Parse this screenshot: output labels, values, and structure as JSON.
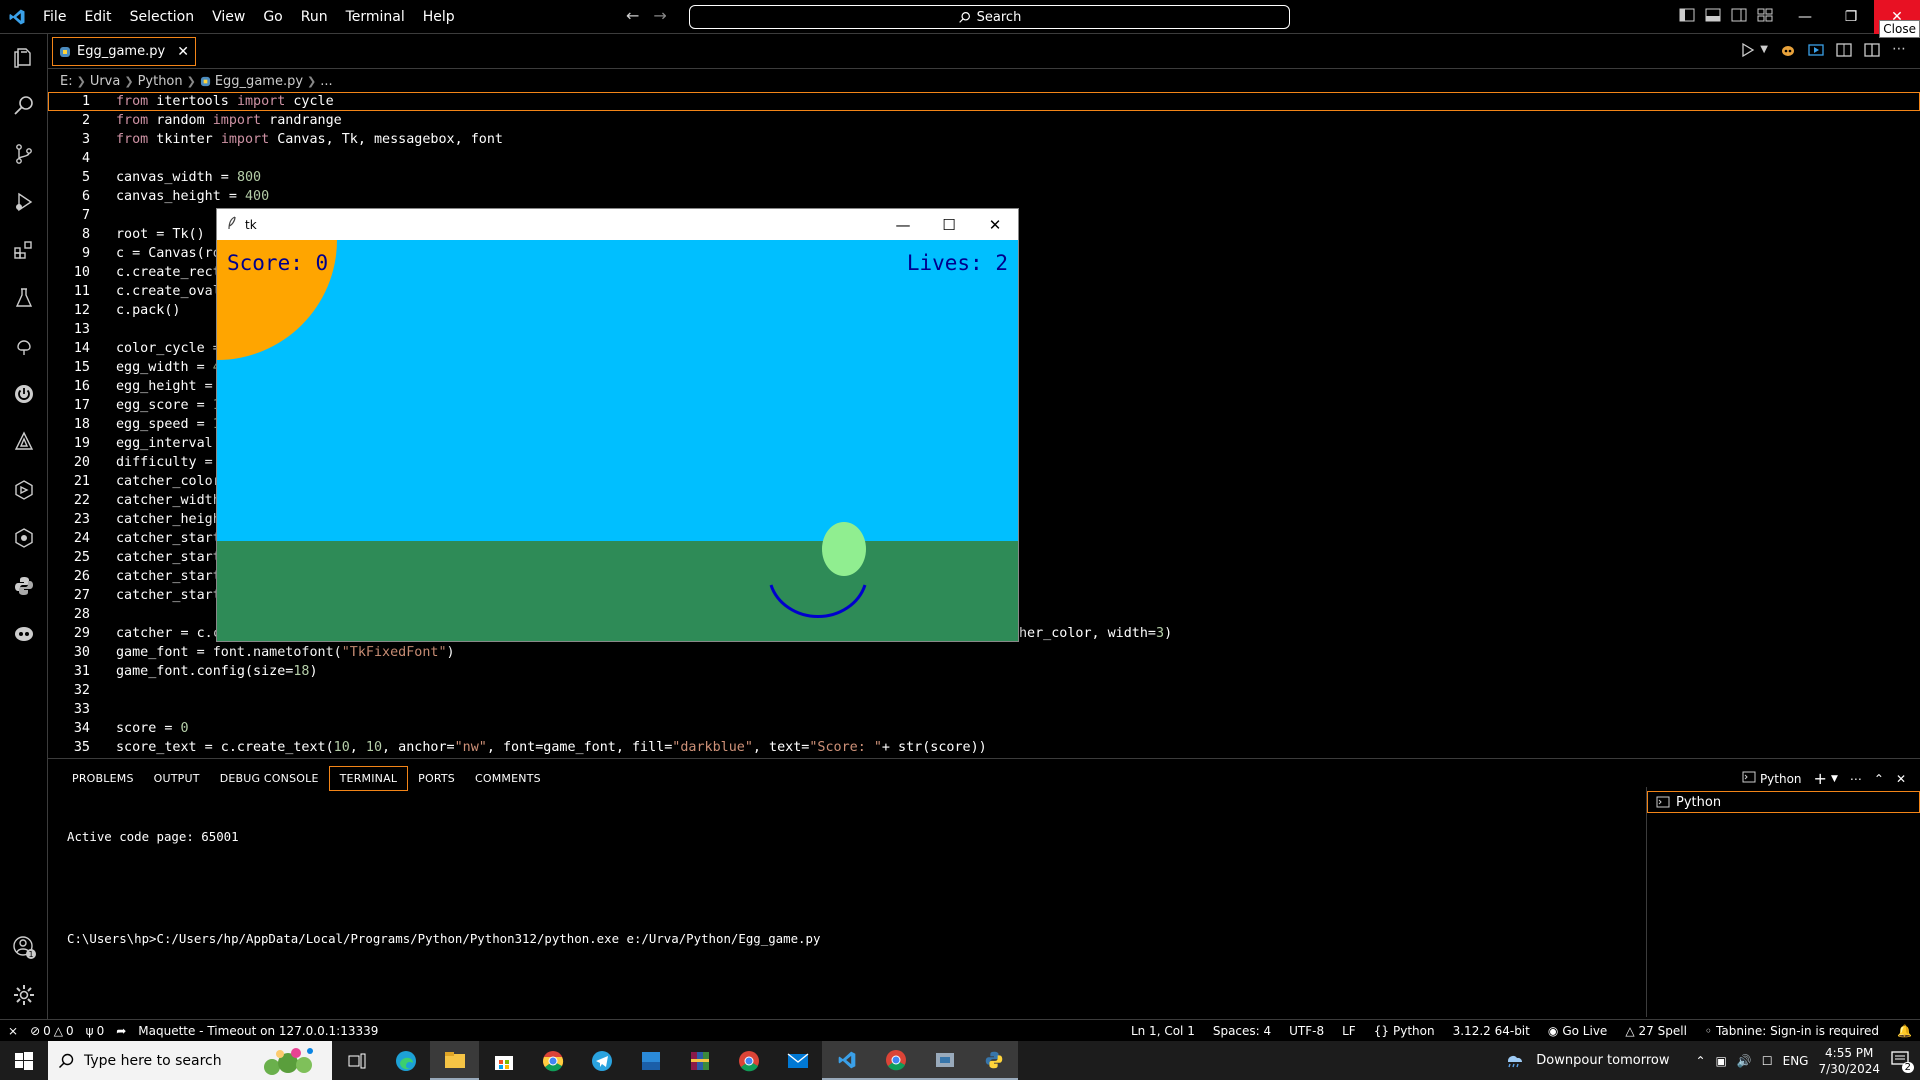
{
  "titlebar": {
    "menu": [
      "File",
      "Edit",
      "Selection",
      "View",
      "Go",
      "Run",
      "Terminal",
      "Help"
    ],
    "search_label": "Search",
    "close_tooltip": "Close"
  },
  "tab": {
    "label": "Egg_game.py"
  },
  "breadcrumb": [
    "E:",
    "Urva",
    "Python",
    "Egg_game.py",
    "..."
  ],
  "code": [
    {
      "n": "1",
      "t": "from itertools import cycle"
    },
    {
      "n": "2",
      "t": "from random import randrange"
    },
    {
      "n": "3",
      "t": "from tkinter import Canvas, Tk, messagebox, font"
    },
    {
      "n": "4",
      "t": ""
    },
    {
      "n": "5",
      "t": "canvas_width = 800"
    },
    {
      "n": "6",
      "t": "canvas_height = 400"
    },
    {
      "n": "7",
      "t": ""
    },
    {
      "n": "8",
      "t": "root = Tk()"
    },
    {
      "n": "9",
      "t": "c = Canvas(ro"
    },
    {
      "n": "10",
      "t": "c.create_rect"
    },
    {
      "n": "11",
      "t": "c.create_oval"
    },
    {
      "n": "12",
      "t": "c.pack()"
    },
    {
      "n": "13",
      "t": ""
    },
    {
      "n": "14",
      "t": "color_cycle ="
    },
    {
      "n": "15",
      "t": "egg_width = 4"
    },
    {
      "n": "16",
      "t": "egg_height ="
    },
    {
      "n": "17",
      "t": "egg_score = 1"
    },
    {
      "n": "18",
      "t": "egg_speed = 1"
    },
    {
      "n": "19",
      "t": "egg_interval"
    },
    {
      "n": "20",
      "t": "difficulty ="
    },
    {
      "n": "21",
      "t": "catcher_color"
    },
    {
      "n": "22",
      "t": "catcher_width"
    },
    {
      "n": "23",
      "t": "catcher_heigh"
    },
    {
      "n": "24",
      "t": "catcher_start"
    },
    {
      "n": "25",
      "t": "catcher_start"
    },
    {
      "n": "26",
      "t": "catcher_start"
    },
    {
      "n": "27",
      "t": "catcher_start"
    },
    {
      "n": "28",
      "t": ""
    },
    {
      "n": "29",
      "t": "catcher = c.c                                                                               =\"arc\", outline=catcher_color, width=3)"
    },
    {
      "n": "30",
      "t": "game_font = font.nametofont(\"TkFixedFont\")"
    },
    {
      "n": "31",
      "t": "game_font.config(size=18)"
    },
    {
      "n": "32",
      "t": ""
    },
    {
      "n": "33",
      "t": ""
    },
    {
      "n": "34",
      "t": "score = 0"
    },
    {
      "n": "35",
      "t": "score_text = c.create_text(10, 10, anchor=\"nw\", font=game_font, fill=\"darkblue\", text=\"Score: \"+ str(score))"
    }
  ],
  "panel": {
    "tabs": [
      "PROBLEMS",
      "OUTPUT",
      "DEBUG CONSOLE",
      "TERMINAL",
      "PORTS",
      "COMMENTS"
    ],
    "active_tab": "TERMINAL",
    "shell_label": "Python",
    "terminal_lines": [
      "Active code page: 65001",
      "",
      "C:\\Users\\hp>C:/Users/hp/AppData/Local/Programs/Python/Python312/python.exe e:/Urva/Python/Egg_game.py"
    ],
    "side_terminal": "Python"
  },
  "statusbar": {
    "errors": "0",
    "warnings": "0",
    "ports": "0",
    "maquette": "Maquette - Timeout on 127.0.0.1:13339",
    "position": "Ln 1, Col 1",
    "spaces": "Spaces: 4",
    "encoding": "UTF-8",
    "eol": "LF",
    "language": "Python",
    "interpreter": "3.12.2 64-bit",
    "golive": "Go Live",
    "spell": "27 Spell",
    "tabnine": "Tabnine: Sign-in is required"
  },
  "taskbar": {
    "search_placeholder": "Type here to search",
    "weather": "Downpour tomorrow",
    "lang": "ENG",
    "time": "4:55 PM",
    "date": "7/30/2024",
    "notif_count": "2"
  },
  "tkwindow": {
    "title": "tk",
    "score_text": "Score: 0",
    "lives_text": "Lives: 2",
    "colors": {
      "sky": "#00bfff",
      "grass": "#2e8b57",
      "sun": "#ffa500",
      "egg": "#90ee90",
      "catcher": "#0000cd",
      "text": "#00008b"
    }
  },
  "colors": {
    "accent": "#f38518",
    "close_red": "#e81123"
  }
}
